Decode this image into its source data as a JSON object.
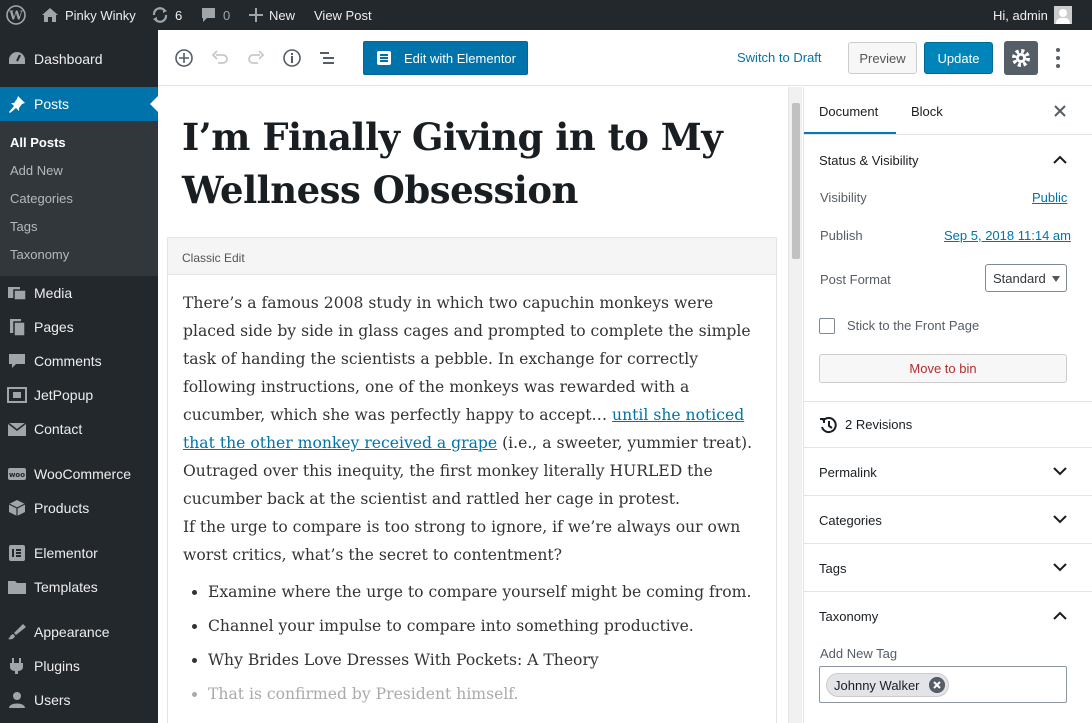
{
  "adminbar": {
    "site_name": "Pinky Winky",
    "updates_count": "6",
    "comments_count": "0",
    "new_label": "New",
    "view_post_label": "View Post",
    "greeting": "Hi, admin"
  },
  "sidebar": {
    "items": [
      {
        "label": "Dashboard",
        "icon": "dashboard-icon"
      },
      {
        "label": "Posts",
        "icon": "pin-icon",
        "active": true
      },
      {
        "label": "Media",
        "icon": "media-icon"
      },
      {
        "label": "Pages",
        "icon": "pages-icon"
      },
      {
        "label": "Comments",
        "icon": "comments-icon"
      },
      {
        "label": "JetPopup",
        "icon": "jetpopup-icon"
      },
      {
        "label": "Contact",
        "icon": "mail-icon"
      },
      {
        "label": "WooCommerce",
        "icon": "woocommerce-icon"
      },
      {
        "label": "Products",
        "icon": "box-icon"
      },
      {
        "label": "Elementor",
        "icon": "elementor-icon"
      },
      {
        "label": "Templates",
        "icon": "folder-icon"
      },
      {
        "label": "Appearance",
        "icon": "brush-icon"
      },
      {
        "label": "Plugins",
        "icon": "plug-icon"
      },
      {
        "label": "Users",
        "icon": "user-icon"
      }
    ],
    "submenu": [
      "All Posts",
      "Add New",
      "Categories",
      "Tags",
      "Taxonomy"
    ]
  },
  "toolbar": {
    "elementor_label": "Edit with Elementor",
    "switch_draft_label": "Switch to Draft",
    "preview_label": "Preview",
    "update_label": "Update"
  },
  "editor": {
    "title": "I’m Finally Giving in to My Wellness Obsession",
    "classic_label": "Classic Edit",
    "para1_a": "There’s a famous 2008 study in which two capuchin monkeys were placed side by side in glass cages and prompted to complete the simple task of handing the scientists a pebble. In exchange for correctly following instructions, one of the monkeys was rewarded with a cucumber, which she was perfectly happy to accept… ",
    "para1_link": "until she noticed that the other monkey received a grape",
    "para1_b": " (i.e., a sweeter, yummier treat). Outraged over this inequity, the first monkey literally HURLED the cucumber back at the scientist and rattled her cage in protest.",
    "para2": "If the urge to compare is too strong to ignore, if we’re always our own worst critics, what’s the secret to contentment?",
    "bullets": [
      "Examine where the urge to compare yourself might be coming from.",
      "Channel your impulse to compare into something productive.",
      "Why Brides Love Dresses With Pockets: A Theory",
      "That is confirmed by President himself."
    ]
  },
  "panel": {
    "tab_document": "Document",
    "tab_block": "Block",
    "status_title": "Status & Visibility",
    "visibility_label": "Visibility",
    "visibility_value": "Public",
    "publish_label": "Publish",
    "publish_value": "Sep 5, 2018 11:14 am",
    "post_format_label": "Post Format",
    "post_format_value": "Standard",
    "front_page_label": "Stick to the Front Page",
    "move_bin_label": "Move to bin",
    "revisions_label": "2 Revisions",
    "permalink_title": "Permalink",
    "categories_title": "Categories",
    "tags_title": "Tags",
    "taxonomy_title": "Taxonomy",
    "add_tag_label": "Add New Tag",
    "tag_chip": "Johnny Walker"
  },
  "colors": {
    "admin_dark": "#23282d",
    "accent_blue": "#0073aa",
    "update_blue": "#0085ba",
    "danger": "#b32d2e"
  }
}
